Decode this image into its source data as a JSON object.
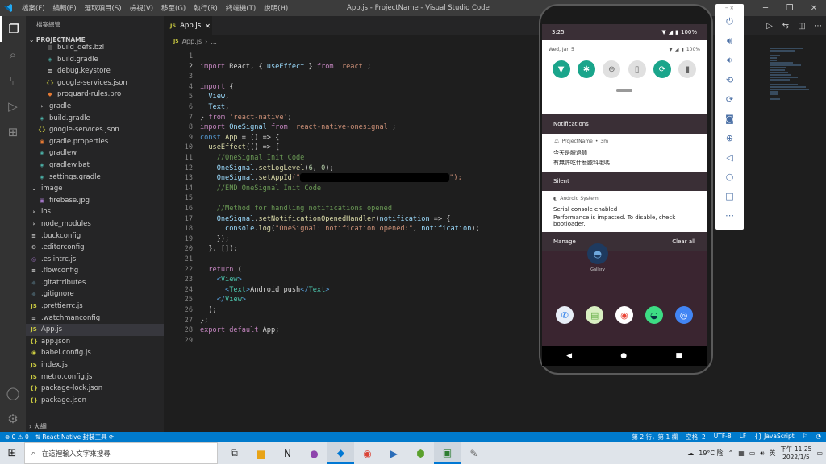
{
  "window": {
    "title": "App.js - ProjectName - Visual Studio Code",
    "menu": [
      "檔案(F)",
      "編輯(E)",
      "選取項目(S)",
      "檢視(V)",
      "移至(G)",
      "執行(R)",
      "終端機(T)",
      "說明(H)"
    ]
  },
  "sidebar": {
    "header": "檔案總管",
    "project": "PROJECTNAME",
    "bottom": "大綱",
    "items": [
      {
        "label": "build_defs.bzl",
        "icon": "file-icon",
        "indent": 2,
        "color": "#999999",
        "glyph": "▤"
      },
      {
        "label": "build.gradle",
        "icon": "gradle-icon",
        "indent": 2,
        "color": "#4db6ac",
        "glyph": "◈"
      },
      {
        "label": "debug.keystore",
        "icon": "file-icon",
        "indent": 2,
        "color": "#cccccc",
        "glyph": "≡"
      },
      {
        "label": "google-services.json",
        "icon": "json-icon",
        "indent": 2,
        "color": "#cbcb41",
        "glyph": "{}"
      },
      {
        "label": "proguard-rules.pro",
        "icon": "proguard-icon",
        "indent": 2,
        "color": "#e37933",
        "glyph": "◆"
      },
      {
        "label": "gradle",
        "icon": "folder-icon",
        "indent": 1,
        "color": "#cccccc",
        "glyph": "›"
      },
      {
        "label": "build.gradle",
        "icon": "gradle-icon",
        "indent": 1,
        "color": "#4db6ac",
        "glyph": "◈"
      },
      {
        "label": "google-services.json",
        "icon": "json-icon",
        "indent": 1,
        "color": "#cbcb41",
        "glyph": "{}"
      },
      {
        "label": "gradle.properties",
        "icon": "properties-icon",
        "indent": 1,
        "color": "#e37933",
        "glyph": "◉"
      },
      {
        "label": "gradlew",
        "icon": "gradle-icon",
        "indent": 1,
        "color": "#4db6ac",
        "glyph": "◈"
      },
      {
        "label": "gradlew.bat",
        "icon": "gradle-icon",
        "indent": 1,
        "color": "#4db6ac",
        "glyph": "◈"
      },
      {
        "label": "settings.gradle",
        "icon": "gradle-icon",
        "indent": 1,
        "color": "#4db6ac",
        "glyph": "◈"
      },
      {
        "label": "image",
        "icon": "folder-icon",
        "indent": 0,
        "color": "#cccccc",
        "glyph": "⌄"
      },
      {
        "label": "firebase.jpg",
        "icon": "image-icon",
        "indent": 1,
        "color": "#a074c4",
        "glyph": "▣"
      },
      {
        "label": "ios",
        "icon": "folder-icon",
        "indent": 0,
        "color": "#cccccc",
        "glyph": "›"
      },
      {
        "label": "node_modules",
        "icon": "folder-icon",
        "indent": 0,
        "color": "#cccccc",
        "glyph": "›"
      },
      {
        "label": ".buckconfig",
        "icon": "file-icon",
        "indent": 0,
        "color": "#cccccc",
        "glyph": "≡"
      },
      {
        "label": ".editorconfig",
        "icon": "gear-icon",
        "indent": 0,
        "color": "#cccccc",
        "glyph": "⚙"
      },
      {
        "label": ".eslintrc.js",
        "icon": "eslint-icon",
        "indent": 0,
        "color": "#a074c4",
        "glyph": "◎"
      },
      {
        "label": ".flowconfig",
        "icon": "file-icon",
        "indent": 0,
        "color": "#cccccc",
        "glyph": "≡"
      },
      {
        "label": ".gitattributes",
        "icon": "git-icon",
        "indent": 0,
        "color": "#41535b",
        "glyph": "◆"
      },
      {
        "label": ".gitignore",
        "icon": "git-icon",
        "indent": 0,
        "color": "#41535b",
        "glyph": "◆"
      },
      {
        "label": ".prettierrc.js",
        "icon": "js-icon",
        "indent": 0,
        "color": "#cbcb41",
        "glyph": "JS"
      },
      {
        "label": ".watchmanconfig",
        "icon": "file-icon",
        "indent": 0,
        "color": "#cccccc",
        "glyph": "≡"
      },
      {
        "label": "App.js",
        "icon": "js-icon",
        "indent": 0,
        "color": "#cbcb41",
        "glyph": "JS",
        "selected": true
      },
      {
        "label": "app.json",
        "icon": "json-icon",
        "indent": 0,
        "color": "#cbcb41",
        "glyph": "{}"
      },
      {
        "label": "babel.config.js",
        "icon": "babel-icon",
        "indent": 0,
        "color": "#cbcb41",
        "glyph": "◉"
      },
      {
        "label": "index.js",
        "icon": "js-icon",
        "indent": 0,
        "color": "#cbcb41",
        "glyph": "JS"
      },
      {
        "label": "metro.config.js",
        "icon": "js-icon",
        "indent": 0,
        "color": "#cbcb41",
        "glyph": "JS"
      },
      {
        "label": "package-lock.json",
        "icon": "json-icon",
        "indent": 0,
        "color": "#cbcb41",
        "glyph": "{}"
      },
      {
        "label": "package.json",
        "icon": "json-icon",
        "indent": 0,
        "color": "#cbcb41",
        "glyph": "{}"
      }
    ]
  },
  "editor": {
    "tab": "App.js",
    "breadcrumb": [
      "App.js",
      "..."
    ],
    "current_line": 2,
    "lines": [
      [
        {
          "t": "",
          "c": ""
        }
      ],
      [
        {
          "t": "import",
          "c": "kw"
        },
        {
          "t": " React, { ",
          "c": ""
        },
        {
          "t": "useEffect",
          "c": "vr"
        },
        {
          "t": " } ",
          "c": ""
        },
        {
          "t": "from",
          "c": "kw"
        },
        {
          "t": " 'react'",
          "c": "st"
        },
        {
          "t": ";",
          "c": ""
        }
      ],
      [
        {
          "t": "",
          "c": ""
        }
      ],
      [
        {
          "t": "import",
          "c": "kw"
        },
        {
          "t": " {",
          "c": ""
        }
      ],
      [
        {
          "t": "  ",
          "c": ""
        },
        {
          "t": "View",
          "c": "vr"
        },
        {
          "t": ",",
          "c": ""
        }
      ],
      [
        {
          "t": "  ",
          "c": ""
        },
        {
          "t": "Text",
          "c": "vr"
        },
        {
          "t": ",",
          "c": ""
        }
      ],
      [
        {
          "t": "} ",
          "c": ""
        },
        {
          "t": "from",
          "c": "kw"
        },
        {
          "t": " 'react-native'",
          "c": "st"
        },
        {
          "t": ";",
          "c": ""
        }
      ],
      [
        {
          "t": "import",
          "c": "kw"
        },
        {
          "t": " OneSignal ",
          "c": "vr"
        },
        {
          "t": "from",
          "c": "kw"
        },
        {
          "t": " 'react-native-onesignal'",
          "c": "st"
        },
        {
          "t": ";",
          "c": ""
        }
      ],
      [
        {
          "t": "const",
          "c": "kb"
        },
        {
          "t": " ",
          "c": ""
        },
        {
          "t": "App",
          "c": "fn"
        },
        {
          "t": " = () => {",
          "c": ""
        }
      ],
      [
        {
          "t": "  ",
          "c": ""
        },
        {
          "t": "useEffect",
          "c": "fn"
        },
        {
          "t": "(() => {",
          "c": ""
        }
      ],
      [
        {
          "t": "    ",
          "c": ""
        },
        {
          "t": "//OneSignal Init Code",
          "c": "cm"
        }
      ],
      [
        {
          "t": "    ",
          "c": ""
        },
        {
          "t": "OneSignal",
          "c": "vr"
        },
        {
          "t": ".",
          "c": ""
        },
        {
          "t": "setLogLevel",
          "c": "fn"
        },
        {
          "t": "(",
          "c": ""
        },
        {
          "t": "6",
          "c": "nm"
        },
        {
          "t": ", ",
          "c": ""
        },
        {
          "t": "0",
          "c": "nm"
        },
        {
          "t": ");",
          "c": ""
        }
      ],
      [
        {
          "t": "    ",
          "c": ""
        },
        {
          "t": "OneSignal",
          "c": "vr"
        },
        {
          "t": ".",
          "c": ""
        },
        {
          "t": "setAppId",
          "c": "fn"
        },
        {
          "t": "(\"",
          "c": "st"
        },
        {
          "t": "REDACT",
          "c": "redact"
        },
        {
          "t": "\");",
          "c": "st"
        }
      ],
      [
        {
          "t": "    ",
          "c": ""
        },
        {
          "t": "//END OneSignal Init Code",
          "c": "cm"
        }
      ],
      [
        {
          "t": "",
          "c": ""
        }
      ],
      [
        {
          "t": "    ",
          "c": ""
        },
        {
          "t": "//Method for handling notifications opened",
          "c": "cm"
        }
      ],
      [
        {
          "t": "    ",
          "c": ""
        },
        {
          "t": "OneSignal",
          "c": "vr"
        },
        {
          "t": ".",
          "c": ""
        },
        {
          "t": "setNotificationOpenedHandler",
          "c": "fn"
        },
        {
          "t": "(",
          "c": ""
        },
        {
          "t": "notification",
          "c": "vr"
        },
        {
          "t": " => {",
          "c": ""
        }
      ],
      [
        {
          "t": "      ",
          "c": ""
        },
        {
          "t": "console",
          "c": "vr"
        },
        {
          "t": ".",
          "c": ""
        },
        {
          "t": "log",
          "c": "fn"
        },
        {
          "t": "(",
          "c": ""
        },
        {
          "t": "\"OneSignal: notification opened:\"",
          "c": "st"
        },
        {
          "t": ", ",
          "c": ""
        },
        {
          "t": "notification",
          "c": "vr"
        },
        {
          "t": ");",
          "c": ""
        }
      ],
      [
        {
          "t": "    });",
          "c": ""
        }
      ],
      [
        {
          "t": "  }, []);",
          "c": ""
        }
      ],
      [
        {
          "t": "",
          "c": ""
        }
      ],
      [
        {
          "t": "  ",
          "c": ""
        },
        {
          "t": "return",
          "c": "kw"
        },
        {
          "t": " (",
          "c": ""
        }
      ],
      [
        {
          "t": "    <",
          "c": "tg"
        },
        {
          "t": "View",
          "c": "tgn"
        },
        {
          "t": ">",
          "c": "tg"
        }
      ],
      [
        {
          "t": "      <",
          "c": "tg"
        },
        {
          "t": "Text",
          "c": "tgn"
        },
        {
          "t": ">",
          "c": "tg"
        },
        {
          "t": "Android push",
          "c": ""
        },
        {
          "t": "</",
          "c": "tg"
        },
        {
          "t": "Text",
          "c": "tgn"
        },
        {
          "t": ">",
          "c": "tg"
        }
      ],
      [
        {
          "t": "    </",
          "c": "tg"
        },
        {
          "t": "View",
          "c": "tgn"
        },
        {
          "t": ">",
          "c": "tg"
        }
      ],
      [
        {
          "t": "  );",
          "c": ""
        }
      ],
      [
        {
          "t": "};",
          "c": ""
        }
      ],
      [
        {
          "t": "export",
          "c": "kw"
        },
        {
          "t": " ",
          "c": ""
        },
        {
          "t": "default",
          "c": "kw"
        },
        {
          "t": " App;",
          "c": ""
        }
      ],
      [
        {
          "t": "",
          "c": ""
        }
      ]
    ]
  },
  "phone": {
    "time": "3:25",
    "battery": "100%",
    "date": "Wed, Jan 5",
    "notifications_header": "Notifications",
    "notif1": {
      "app": "ProjectName",
      "time": "3m",
      "line1": "今天是臘退節",
      "line2": "有無許吃什麼臘料哦嗎"
    },
    "silent_header": "Silent",
    "notif2": {
      "app": "Android System",
      "title": "Serial console enabled",
      "body": "Performance is impacted. To disable, check bootloader."
    },
    "manage": "Manage",
    "clear_all": "Clear all",
    "gallery_label": "Gallery"
  },
  "statusbar": {
    "errors": "0",
    "warnings": "0",
    "rn_tools": "React Native 封裝工具",
    "position": "第 2 行，第 1 欄",
    "spaces": "空格: 2",
    "encoding": "UTF-8",
    "eol": "LF",
    "language": "JavaScript"
  },
  "taskbar": {
    "search_placeholder": "在這裡輸入文字來搜尋",
    "weather": "19°C 陰",
    "ime": "英",
    "time": "下午 11:25",
    "date": "2022/1/5"
  }
}
